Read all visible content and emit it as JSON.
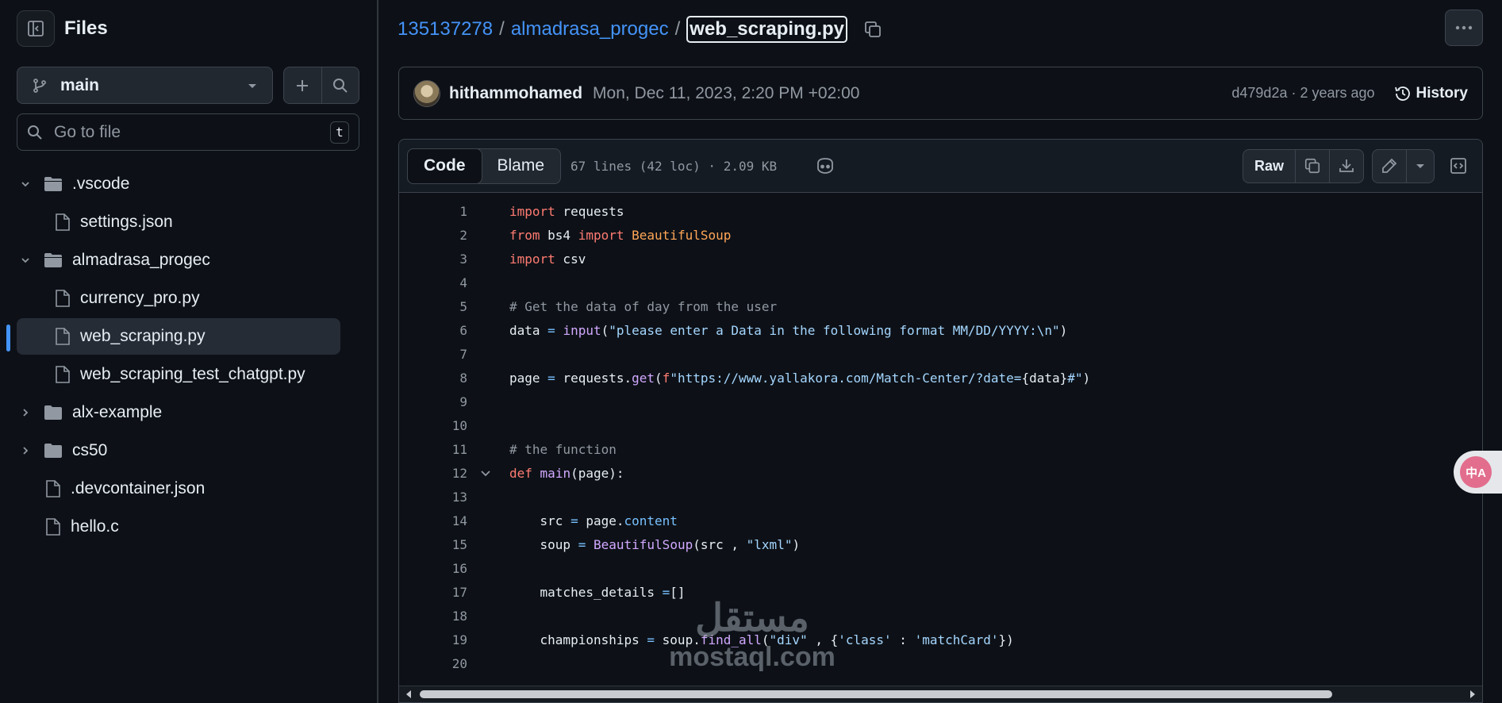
{
  "sidebar": {
    "title": "Files",
    "branch": "main",
    "search_placeholder": "Go to file",
    "search_shortcut": "t",
    "tree": [
      {
        "label": ".vscode",
        "type": "folder",
        "expanded": true
      },
      {
        "label": "settings.json",
        "type": "file"
      },
      {
        "label": "almadrasa_progec",
        "type": "folder",
        "expanded": true
      },
      {
        "label": "currency_pro.py",
        "type": "file"
      },
      {
        "label": "web_scraping.py",
        "type": "file",
        "selected": true
      },
      {
        "label": "web_scraping_test_chatgpt.py",
        "type": "file"
      },
      {
        "label": "alx-example",
        "type": "folder",
        "expanded": false
      },
      {
        "label": "cs50",
        "type": "folder",
        "expanded": false
      },
      {
        "label": ".devcontainer.json",
        "type": "file"
      },
      {
        "label": "hello.c",
        "type": "file"
      }
    ]
  },
  "breadcrumb": {
    "repo": "135137278",
    "folder": "almadrasa_progec",
    "file": "web_scraping.py",
    "separator": "/"
  },
  "commit": {
    "author": "hithammohamed",
    "date": "Mon, Dec 11, 2023, 2:20 PM +02:00",
    "sha_age": "d479d2a · 2 years ago",
    "history_label": "History"
  },
  "code_header": {
    "tab_code": "Code",
    "tab_blame": "Blame",
    "meta": "67 lines (42 loc) · 2.09 KB",
    "raw_label": "Raw"
  },
  "code": {
    "line_numbers": [
      "1",
      "2",
      "3",
      "4",
      "5",
      "6",
      "7",
      "8",
      "9",
      "10",
      "11",
      "12",
      "13",
      "14",
      "15",
      "16",
      "17",
      "18",
      "19",
      "20"
    ],
    "foldable_line": "12"
  },
  "watermark": {
    "arabic": "مستقل",
    "latin": "mostaql.com"
  },
  "translate_badge": "中A",
  "colors": {
    "accent": "#4493f8",
    "background": "#0d1117",
    "keyword": "#ff7b72",
    "function": "#d2a8ff",
    "string": "#a5d6ff",
    "comment": "#9198a1"
  }
}
